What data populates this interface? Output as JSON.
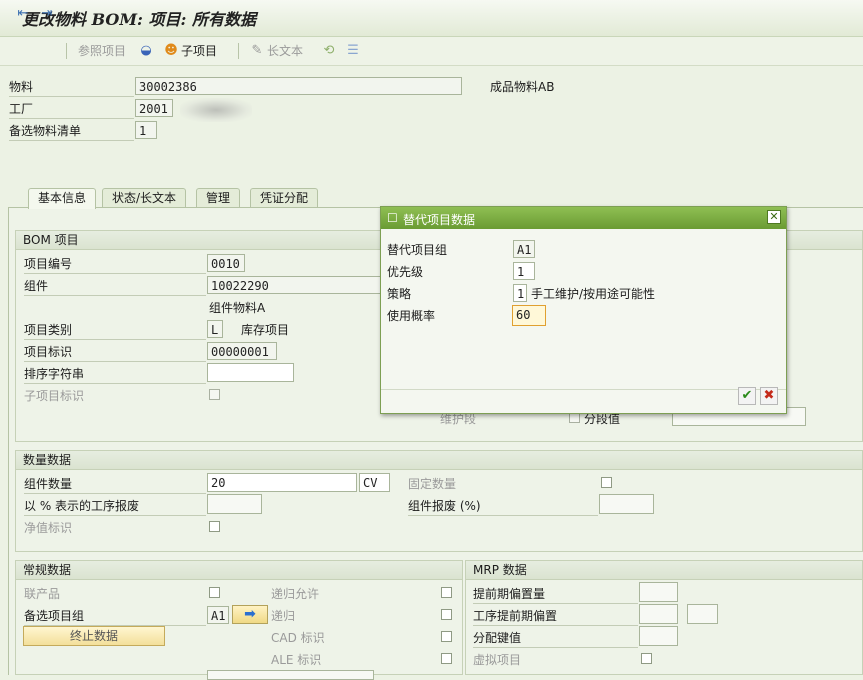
{
  "window": {
    "title": "更改物料 BOM: 项目: 所有数据"
  },
  "toolbar": {
    "ref_item": "参照项目",
    "sub_item": "子项目",
    "long_text": "长文本"
  },
  "header": {
    "material_label": "物料",
    "material_value": "30002386",
    "material_desc": "成品物料AB",
    "plant_label": "工厂",
    "plant_value": "2001",
    "alt_bom_label": "备选物料清单",
    "alt_bom_value": "1"
  },
  "tabs": [
    "基本信息",
    "状态/长文本",
    "管理",
    "凭证分配"
  ],
  "bom_item": {
    "title": "BOM 项目",
    "item_no_label": "项目编号",
    "item_no_value": "0010",
    "component_label": "组件",
    "component_value": "10022290",
    "component_desc": "组件物料A",
    "item_cat_label": "项目类别",
    "item_cat_value": "L",
    "item_cat_desc": "库存项目",
    "item_id_label": "项目标识",
    "item_id_value": "00000001",
    "sort_label": "排序字符串",
    "sort_value": "",
    "sub_item_label": "子项目标识",
    "partial_right_label1": "维护段",
    "partial_right_label2": "分段值"
  },
  "qty_data": {
    "title": "数量数据",
    "comp_qty_label": "组件数量",
    "comp_qty_value": "20",
    "unit_value": "CV",
    "fixed_qty_label": "固定数量",
    "op_scrap_label": "以 % 表示的工序报废",
    "comp_scrap_label": "组件报废 (%)",
    "net_label": "净值标识"
  },
  "general": {
    "title": "常规数据",
    "coproduct_label": "联产品",
    "recursive_allowed_label": "递归允许",
    "alt_group_label": "备选项目组",
    "alt_group_value": "A1",
    "recursive_label": "递归",
    "stop_button": "终止数据",
    "cad_label": "CAD 标识",
    "ale_label": "ALE 标识"
  },
  "mrp": {
    "title": "MRP 数据",
    "lead_offset_label": "提前期偏置量",
    "op_lead_offset_label": "工序提前期偏置",
    "dist_key_label": "分配键值",
    "phantom_label": "虚拟项目"
  },
  "dialog": {
    "title": "替代项目数据",
    "group_label": "替代项目组",
    "group_value": "A1",
    "priority_label": "优先级",
    "priority_value": "1",
    "strategy_label": "策略",
    "strategy_value": "1",
    "strategy_desc": "手工维护/按用途可能性",
    "usage_label": "使用概率",
    "usage_value": "60"
  },
  "colors": {
    "dialog_title_bg": "#7fae45",
    "background": "#ecf2e4",
    "stop_button_bg": "#f3df9a"
  }
}
